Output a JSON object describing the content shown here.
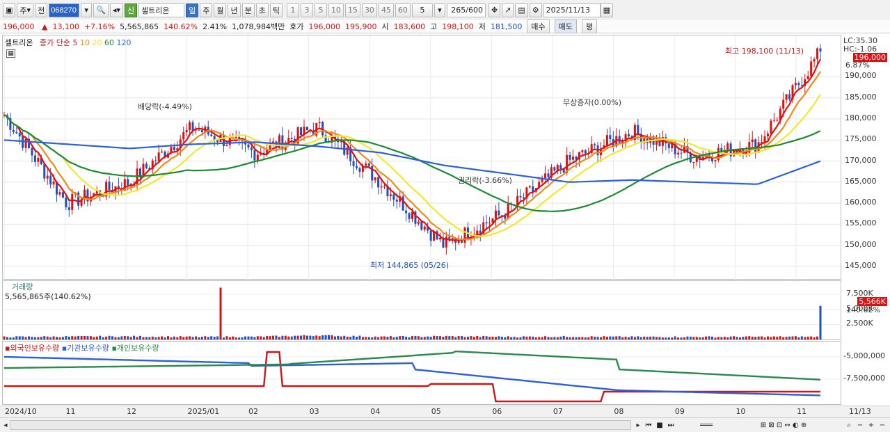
{
  "toolbar": {
    "period_main": "주",
    "prev_label": "전",
    "code": "068270",
    "badge_new": "신",
    "stock_name": "셀트리온",
    "period_tabs": [
      "일",
      "주",
      "월",
      "년",
      "분",
      "초",
      "틱"
    ],
    "interval_buttons": [
      "1",
      "3",
      "5",
      "10",
      "15",
      "30",
      "45",
      "60"
    ],
    "interval_value": "5",
    "count": "265",
    "count_total": "/600",
    "date": "2025/11/13"
  },
  "quote": {
    "price": "196,000",
    "change": "13,100",
    "change_pct": "+7.16%",
    "volume": "5,565,865",
    "volume_ratio": "140.62%",
    "turnover": "2.41%",
    "amount": "1,078,984백만",
    "bid_label": "호가",
    "ask": "196,000",
    "bid": "195,900",
    "open_label": "시",
    "open": "183,600",
    "high_label": "고",
    "high": "198,100",
    "low_label": "저",
    "low": "181,500",
    "buy_label": "매수",
    "sell_label": "매도",
    "eval_label": "평"
  },
  "price_panel": {
    "stock_name": "셀트리온",
    "ma_label": "종가 단순",
    "ma_periods": [
      "5",
      "10",
      "20",
      "60",
      "120"
    ],
    "ma_colors": [
      "#e01010",
      "#f08a16",
      "#f2e82a",
      "#1b8b2f",
      "#2c5fe0"
    ],
    "lc_text": "LC:35.30",
    "hc_text": "HC:-1.06",
    "current_tag": "196,000",
    "current_pct": "6.87%",
    "high_annot": "최고 198,100 (11/13)",
    "low_annot": "최저 144,865 (05/26)",
    "event_dividend": "배당락(-4.49%)",
    "event_rights": "권리락(-3.66%)",
    "event_bonus": "무상증자(0.00%)",
    "y_ticks": [
      "190,000",
      "185,000",
      "180,000",
      "175,000",
      "170,000",
      "165,000",
      "160,000",
      "155,000",
      "150,000",
      "145,000"
    ]
  },
  "volume_panel": {
    "title": "거래량",
    "value_text": "5,565,865주(140.62%)",
    "y_ticks": [
      "7,500K",
      "5,000K",
      "2,500K"
    ],
    "current_tag": "5,566K",
    "current_pct": "140.62%"
  },
  "holding_panel": {
    "legend": [
      "외국인보유수량",
      "기관보유수량",
      "개인보유수량"
    ],
    "legend_colors": [
      "#d01515",
      "#2c5fe0",
      "#2a8a4a"
    ],
    "y_ticks": [
      "-5,000,000",
      "-7,500,000"
    ]
  },
  "x_axis": {
    "labels": [
      "2024/10",
      "11",
      "12",
      "2025/01",
      "02",
      "03",
      "04",
      "05",
      "06",
      "07",
      "08",
      "09",
      "10",
      "11"
    ],
    "right_label": "11/13"
  },
  "chart_data": {
    "type": "line",
    "title": "셀트리온",
    "x": [
      "2024/10",
      "11",
      "12",
      "2025/01",
      "02",
      "03",
      "04",
      "05",
      "06",
      "07",
      "08",
      "09",
      "10",
      "11"
    ],
    "ylim": [
      143000,
      198500
    ],
    "series": [
      {
        "name": "종가",
        "values": [
          181000,
          160000,
          165000,
          178000,
          172000,
          178000,
          165000,
          150000,
          158000,
          170000,
          177000,
          171000,
          174000,
          196000
        ]
      },
      {
        "name": "120",
        "values": [
          175000,
          174000,
          173000,
          174000,
          174500,
          173500,
          172000,
          169000,
          167000,
          165000,
          165500,
          165000,
          164500,
          170000
        ]
      }
    ],
    "volume_k": [
      300,
      350,
      380,
      300,
      320,
      560,
      300,
      400,
      320,
      350,
      300,
      300,
      320,
      5566
    ],
    "annotations": [
      "최고 198,100 (11/13)",
      "최저 144,865 (05/26)",
      "배당락(-4.49%)",
      "권리락(-3.66%)",
      "무상증자(0.00%)"
    ]
  }
}
